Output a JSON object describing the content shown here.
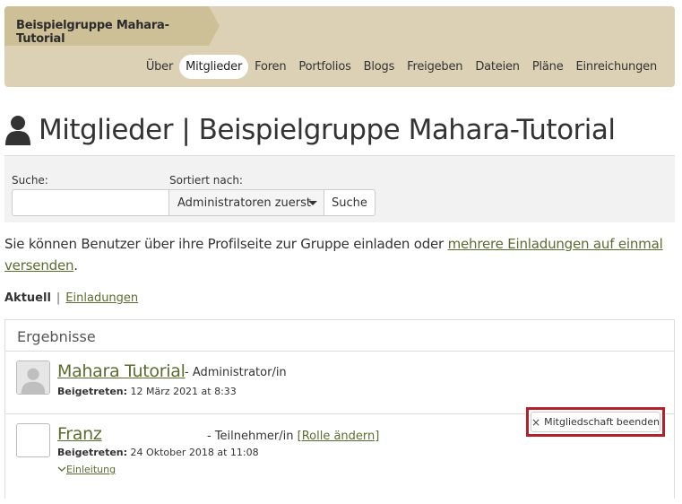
{
  "header": {
    "group_name": "Beispielgruppe Mahara-Tutorial",
    "nav": [
      {
        "label": "Über"
      },
      {
        "label": "Mitglieder",
        "active": true
      },
      {
        "label": "Foren"
      },
      {
        "label": "Portfolios"
      },
      {
        "label": "Blogs"
      },
      {
        "label": "Freigeben"
      },
      {
        "label": "Dateien"
      },
      {
        "label": "Pläne"
      },
      {
        "label": "Einreichungen"
      }
    ]
  },
  "page": {
    "title": "Mitglieder | Beispielgruppe Mahara-Tutorial",
    "title_icon": "user-icon"
  },
  "search": {
    "search_label": "Suche:",
    "search_value": "",
    "sort_label": "Sortiert nach:",
    "sort_selected": "Administratoren zuerst",
    "button_label": "Suche"
  },
  "info": {
    "text": "Sie können Benutzer über ihre Profilseite zur Gruppe einladen oder ",
    "link": "mehrere Einladungen auf einmal versenden",
    "suffix": "."
  },
  "filter": {
    "current": "Aktuell",
    "separator": "|",
    "invitations": "Einladungen"
  },
  "results": {
    "heading": "Ergebnisse",
    "members": [
      {
        "name": "Mahara Tutorial",
        "role": "- Administrator/in",
        "joined_label": "Beigetreten:",
        "joined_value": "12 März 2021 at 8:33"
      },
      {
        "name": "Franz",
        "role": "- Teilnehmer/in",
        "change_role": "[Rolle ändern]",
        "joined_label": "Beigetreten:",
        "joined_value": "24 Oktober 2018 at 11:08",
        "intro_label": "Einleitung",
        "end_membership": "Mitgliedschaft beenden"
      }
    ]
  },
  "colors": {
    "header_bg": "#dcd1b5",
    "group_tab_bg": "#cdbf96",
    "link": "#5c6b2f",
    "highlight_border": "#b3222b"
  }
}
